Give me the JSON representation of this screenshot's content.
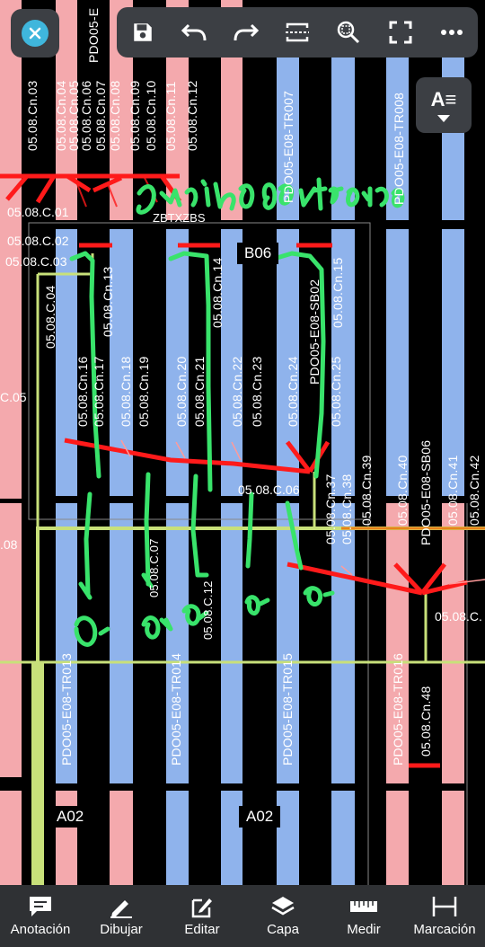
{
  "canvas": {
    "column_labels_top": [
      "05.08.Cn.03",
      "05.08.Cn.04",
      "05.08.Cn.05",
      "05.08.Cn.06",
      "05.08.Cn.07",
      "05.08.Cn.08",
      "05.08.Cn.09",
      "05.08.Cn.10",
      "05.08.Cn.11",
      "05.08.Cn.12"
    ],
    "top_cut_label": "PDO05-E",
    "tr_top": [
      "PDO05-E08-TR007",
      "PDO05-E08-TR008"
    ],
    "left_labels": [
      "05.08.C.01",
      "05.08.C.02",
      "05.08.C.03"
    ],
    "handwritten_note": "Sentido contrario",
    "label_zbt": "ZBTXZBS",
    "box_b06": "B06",
    "mid_labels": [
      "05.08.C.04",
      "05.08.Cn.13",
      "05.08.Cn.14",
      "PDO05-E08-SB02",
      "05.08.Cn.15"
    ],
    "row_labels": [
      "05.08.Cn.16",
      "05.08.Cn.17",
      "05.08.Cn.18",
      "05.08.Cn.19",
      "05.08.Cn.20",
      "05.08.Cn.21",
      "05.08.Cn.22",
      "05.08.Cn.23",
      "05.08.Cn.24",
      "05.08.Cn.25"
    ],
    "left_c05": "C.05",
    "left_08": ".08",
    "label_c06": "05.08.C.06",
    "right_labels": [
      "05.08.Cn.37",
      "05.08.Cn.38",
      "05.08.Cn.39",
      "05.08.Cn.40",
      "PDO05-E08-SB06",
      "05.08.Cn.41",
      "05.08.Cn.42"
    ],
    "label_c07": "05.08.C.07",
    "label_c12": "05.08.C.12",
    "label_c08_right": "05.08.C.",
    "tr_bottom": [
      "PDO05-E08-TR013",
      "PDO05-E08-TR014",
      "PDO05-E08-TR015",
      "PDO05-E08-TR016"
    ],
    "label_cn48": "05.08.Cn.48",
    "box_a02": [
      "A02",
      "A02"
    ],
    "ok_marks": [
      "ok",
      "ok",
      "ok",
      "ok",
      "ok"
    ]
  },
  "toolbar": {
    "close_icon": "close-icon",
    "tools": [
      "save-icon",
      "undo-icon",
      "redo-icon",
      "fit-width-icon",
      "zoom-search-icon",
      "fullscreen-icon",
      "more-icon"
    ],
    "style_label": "A≡"
  },
  "bottom_bar": {
    "items": [
      {
        "label": "Anotación",
        "icon": "comment-icon"
      },
      {
        "label": "Dibujar",
        "icon": "pencil-icon"
      },
      {
        "label": "Editar",
        "icon": "edit-icon"
      },
      {
        "label": "Capa",
        "icon": "layers-icon"
      },
      {
        "label": "Medir",
        "icon": "ruler-icon"
      },
      {
        "label": "Marcación",
        "icon": "dimension-icon"
      }
    ]
  },
  "colors": {
    "pink": "#f4a9ad",
    "blue": "#8fb3ec",
    "red": "#ff1a1a",
    "green_ink": "#39e36b",
    "lime": "#c8e07a",
    "accent": "#3fb6dc",
    "toolbar_bg": "#3c3f44"
  }
}
